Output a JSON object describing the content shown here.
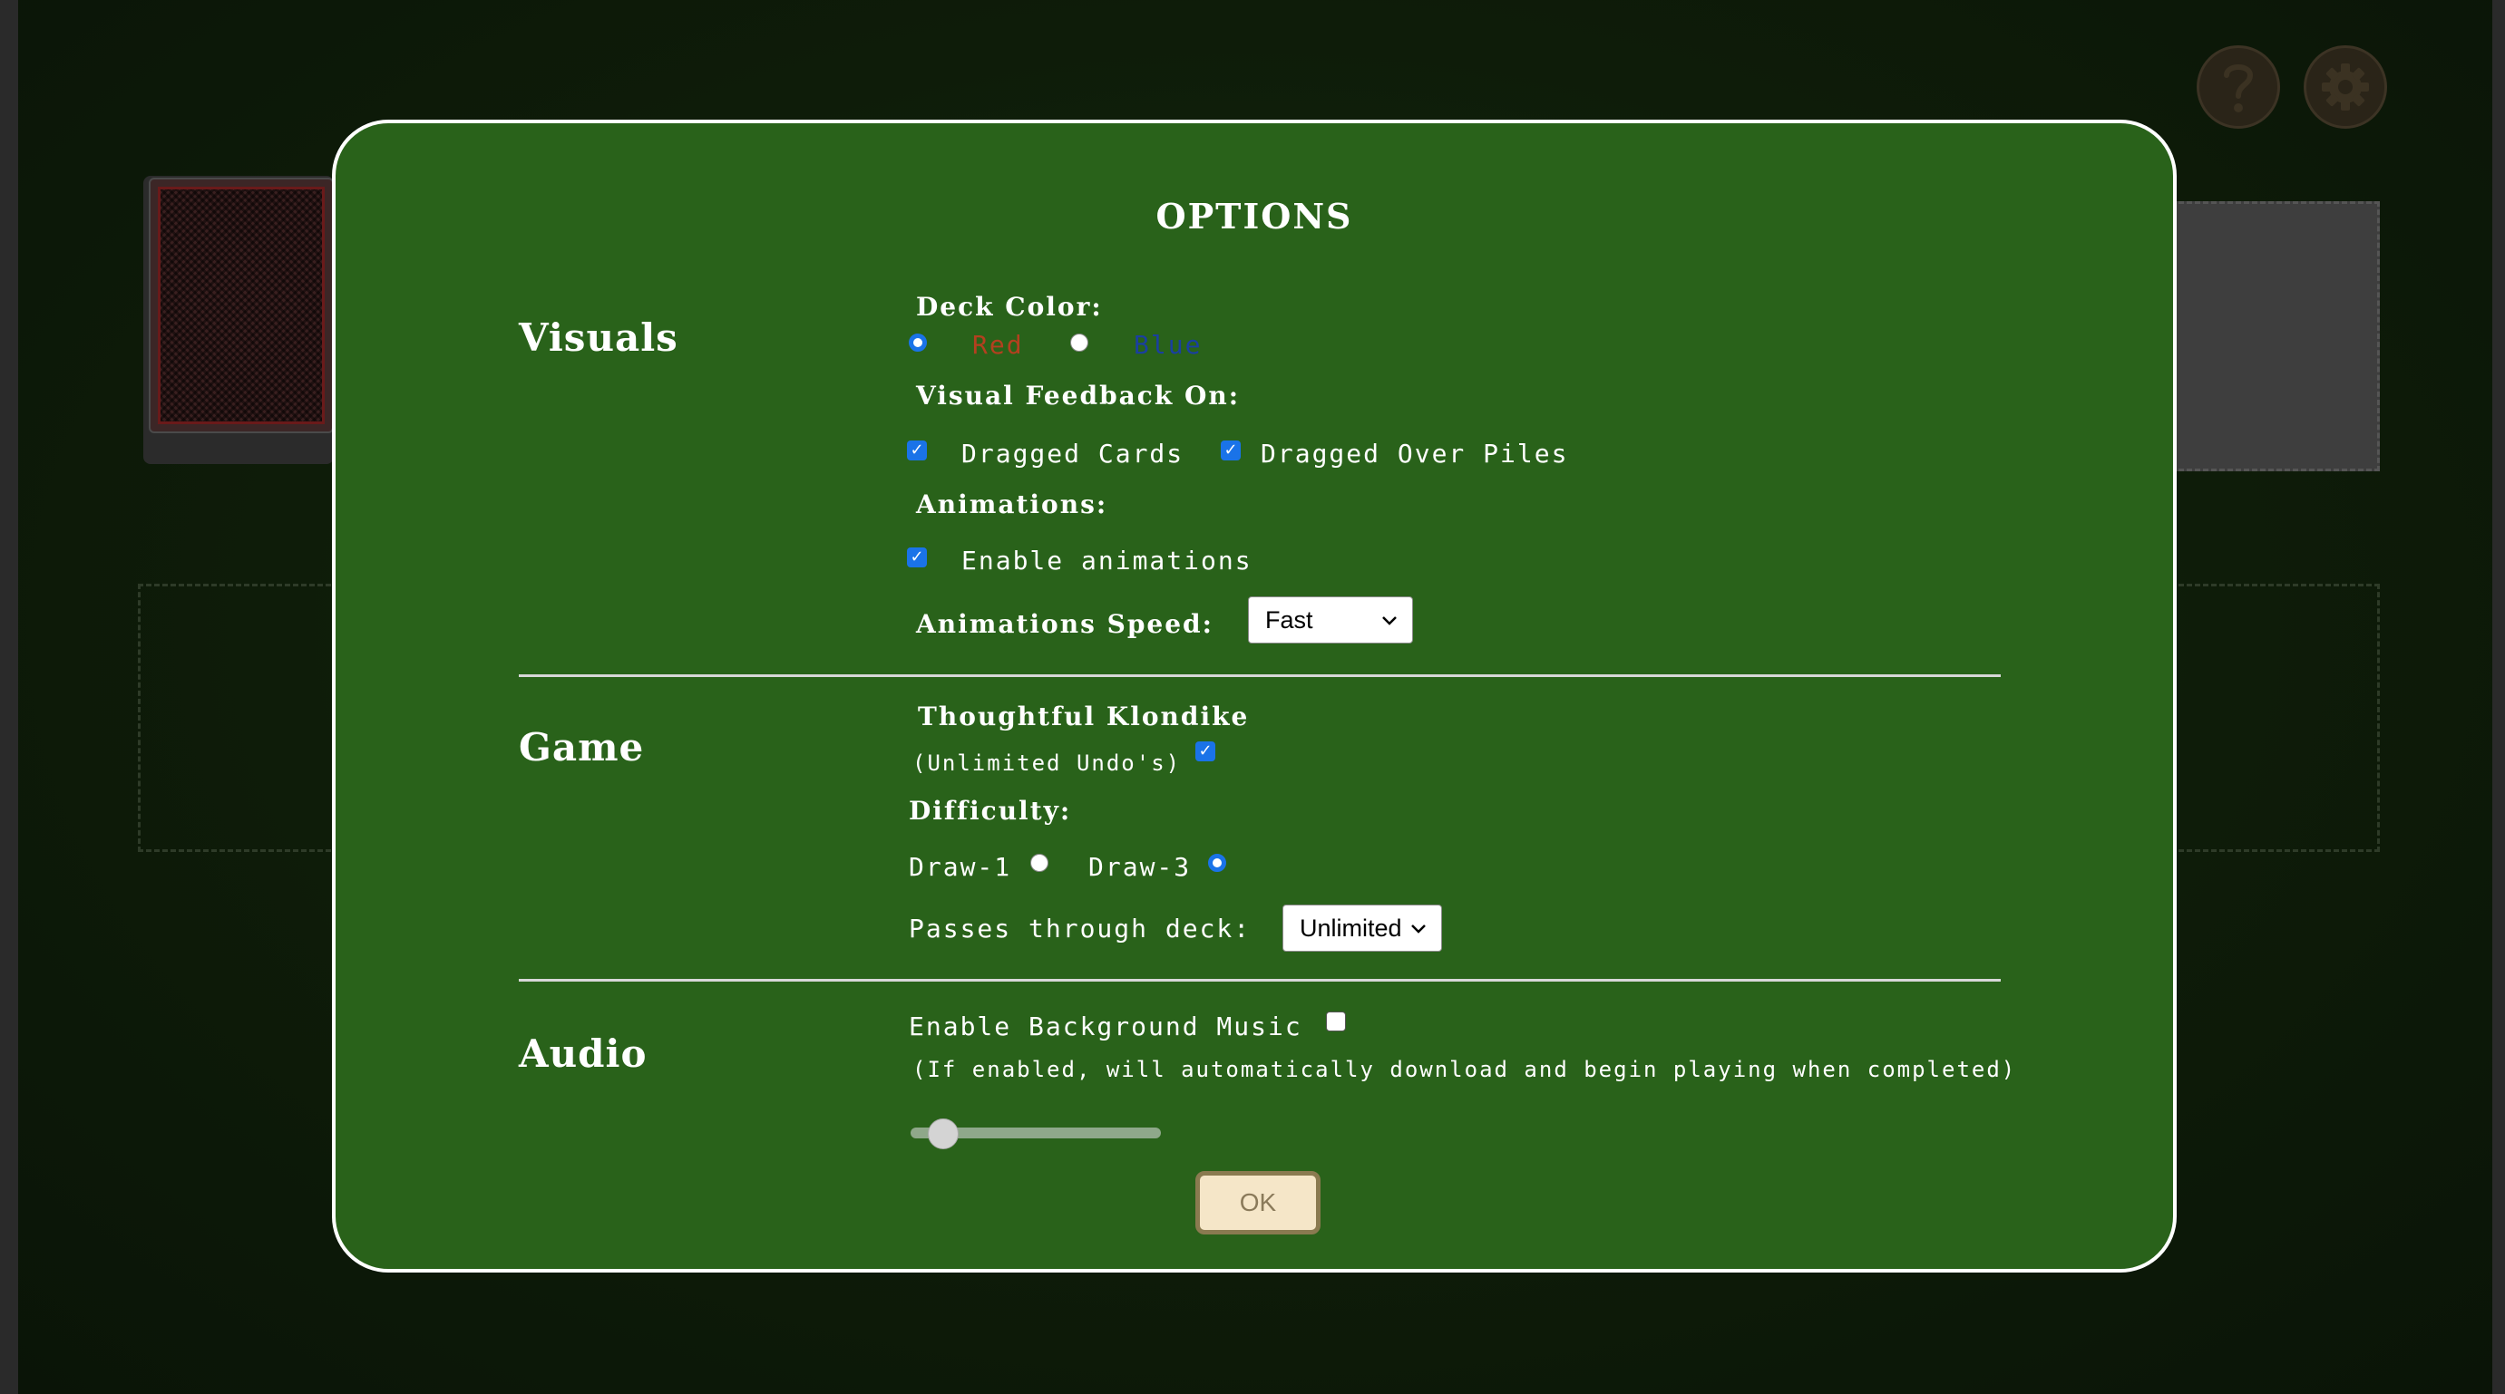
{
  "modal": {
    "title": "OPTIONS",
    "ok_label": "OK"
  },
  "visuals": {
    "section_title": "Visuals",
    "deck_color_label": "Deck Color:",
    "deck_colors": [
      {
        "label": "Red",
        "color": "#b3401f",
        "selected": true
      },
      {
        "label": "Blue",
        "color": "#1a3fa0",
        "selected": false
      }
    ],
    "visual_feedback_label": "Visual Feedback On:",
    "feedback_dragged_cards": {
      "label": "Dragged Cards",
      "checked": true
    },
    "feedback_dragged_over_piles": {
      "label": "Dragged Over Piles",
      "checked": true
    },
    "animations_label": "Animations:",
    "enable_animations": {
      "label": "Enable animations",
      "checked": true
    },
    "animations_speed_label": "Animations Speed:",
    "animations_speed_value": "Fast"
  },
  "game": {
    "section_title": "Game",
    "thoughtful_label": "Thoughtful Klondike",
    "thoughtful_sub": "(Unlimited Undo's)",
    "thoughtful_checked": true,
    "difficulty_label": "Difficulty:",
    "draw_options": [
      {
        "label": "Draw-1",
        "selected": false
      },
      {
        "label": "Draw-3",
        "selected": true
      }
    ],
    "passes_label": "Passes through deck:",
    "passes_value": "Unlimited"
  },
  "audio": {
    "section_title": "Audio",
    "music_label": "Enable Background Music",
    "music_checked": false,
    "music_note": "(If enabled, will automatically download and begin playing when completed)",
    "volume_fraction": 0.08
  },
  "icons": {
    "help": "question-mark-icon",
    "settings": "gear-icon"
  },
  "colors": {
    "modal_bg": "#29621a",
    "accent": "#1a73e8",
    "ok_bg": "#f5e6c8"
  }
}
